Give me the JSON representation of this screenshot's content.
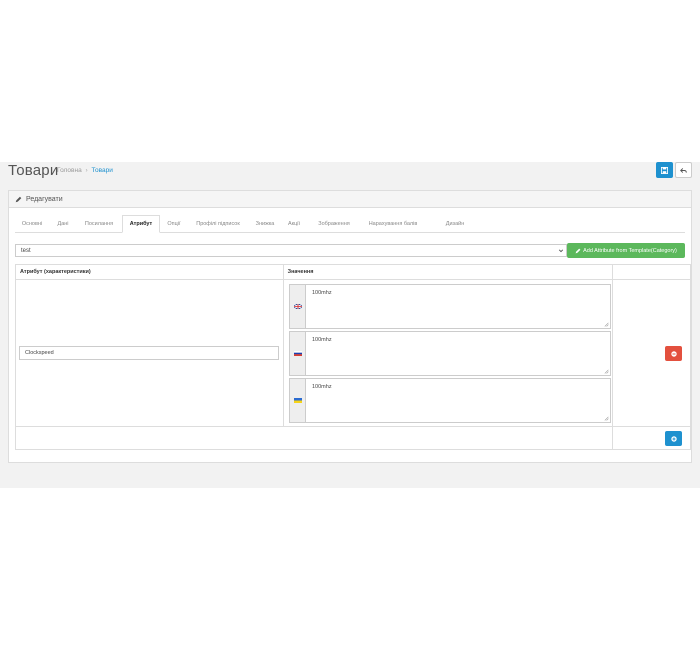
{
  "header": {
    "title": "Товари",
    "breadcrumb": [
      "Головна",
      "Товари"
    ],
    "save_icon": "save-icon",
    "back_icon": "reply-icon"
  },
  "panel": {
    "heading": "Редагувати",
    "heading_icon": "pencil-icon"
  },
  "tabs": [
    {
      "label": "Основні",
      "active": false
    },
    {
      "label": "Дані",
      "active": false
    },
    {
      "label": "Посилання",
      "active": false
    },
    {
      "label": "Атрибут",
      "active": true
    },
    {
      "label": "Опції",
      "active": false
    },
    {
      "label": "Профілі підписок",
      "active": false
    },
    {
      "label": "Знижка",
      "active": false
    },
    {
      "label": "Акції",
      "active": false
    },
    {
      "label": "Зображення",
      "active": false
    },
    {
      "label": "Нарахування балів",
      "active": false
    },
    {
      "label": "Дизайн",
      "active": false
    }
  ],
  "template_select": {
    "value": "test",
    "button_label": "Add Attribute from Template(Category)"
  },
  "table": {
    "headers": [
      "Атрибут (характеристики)",
      "Значення",
      ""
    ],
    "rows": [
      {
        "attribute": "Clockspeed",
        "values": [
          {
            "lang": "en",
            "text": "100mhz"
          },
          {
            "lang": "ru",
            "text": "100mhz"
          },
          {
            "lang": "uk",
            "text": "100mhz"
          }
        ]
      }
    ]
  },
  "colors": {
    "primary": "#1e91cf",
    "success": "#5cb85c",
    "danger": "#e3503e"
  }
}
